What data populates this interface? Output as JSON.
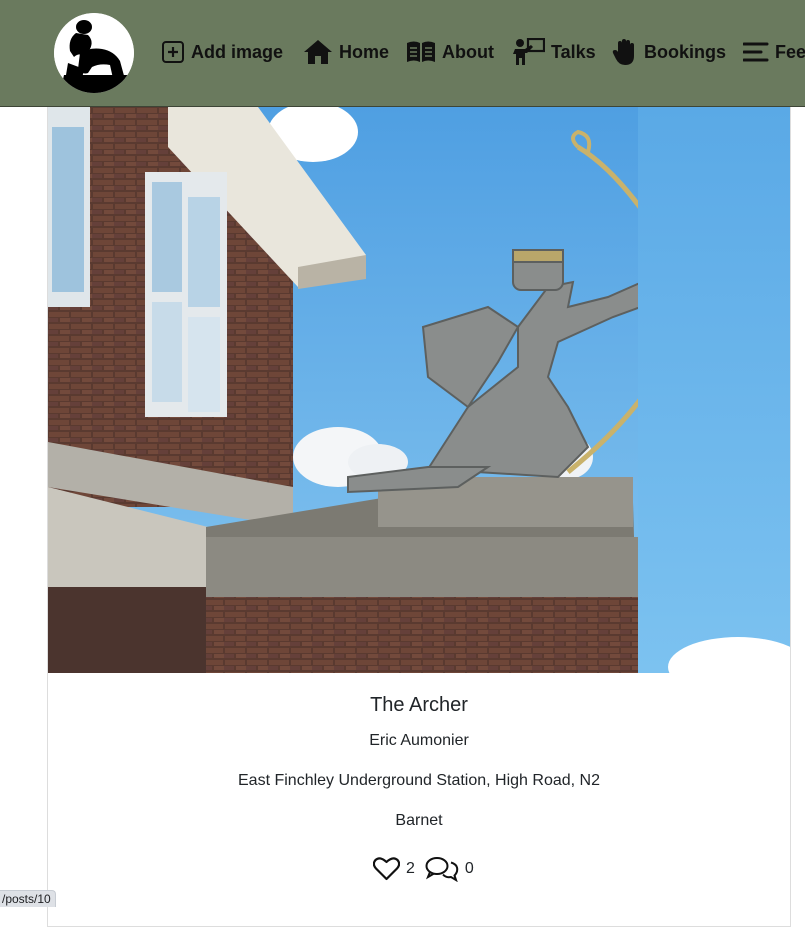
{
  "navbar": {
    "logo_alt": "thinker-silhouette-logo",
    "items": [
      {
        "label": "Add image",
        "icon": "plus-square-icon"
      },
      {
        "label": "Home",
        "icon": "house-icon"
      },
      {
        "label": "About",
        "icon": "open-book-icon"
      },
      {
        "label": "Talks",
        "icon": "presenter-icon"
      },
      {
        "label": "Bookings",
        "icon": "raised-hand-icon"
      },
      {
        "label": "Feedback",
        "icon": "align-left-icon"
      }
    ],
    "background": "#6a7a5e"
  },
  "post": {
    "title": "The Archer",
    "artist": "Eric Aumonier",
    "location": "East Finchley Underground Station, High Road, N2",
    "borough": "Barnet",
    "likes": "2",
    "comments": "0"
  },
  "status_bar": {
    "url": "/posts/10"
  }
}
